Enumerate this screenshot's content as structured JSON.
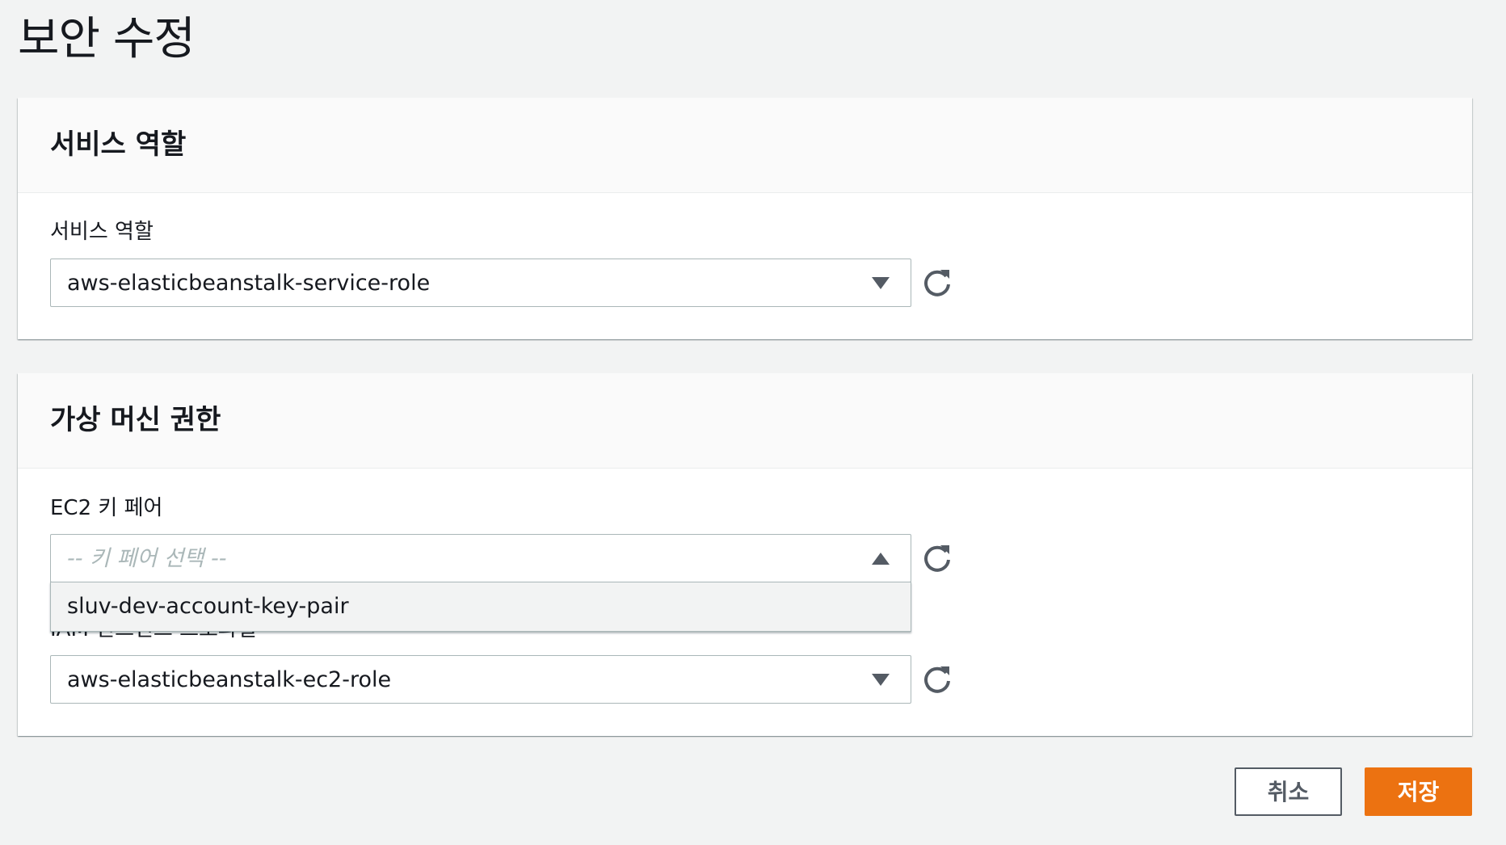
{
  "page": {
    "title": "보안 수정"
  },
  "service_role_panel": {
    "header": "서비스 역할",
    "field_label": "서비스 역할",
    "selected_value": "aws-elasticbeanstalk-service-role"
  },
  "vm_permissions_panel": {
    "header": "가상 머신 권한",
    "key_pair": {
      "label": "EC2 키 페어",
      "placeholder": "-- 키 페어 선택 --",
      "options": [
        "sluv-dev-account-key-pair"
      ]
    },
    "instance_profile": {
      "label": "IAM 인스턴스 프로파일",
      "selected_value": "aws-elasticbeanstalk-ec2-role"
    }
  },
  "actions": {
    "cancel_label": "취소",
    "save_label": "저장"
  },
  "colors": {
    "accent": "#ec7211",
    "background": "#f2f3f3",
    "border": "#aab7b8",
    "text": "#16191f"
  },
  "icons": {
    "refresh": "refresh-icon",
    "caret_down": "caret-down-icon",
    "caret_up": "caret-up-icon"
  }
}
